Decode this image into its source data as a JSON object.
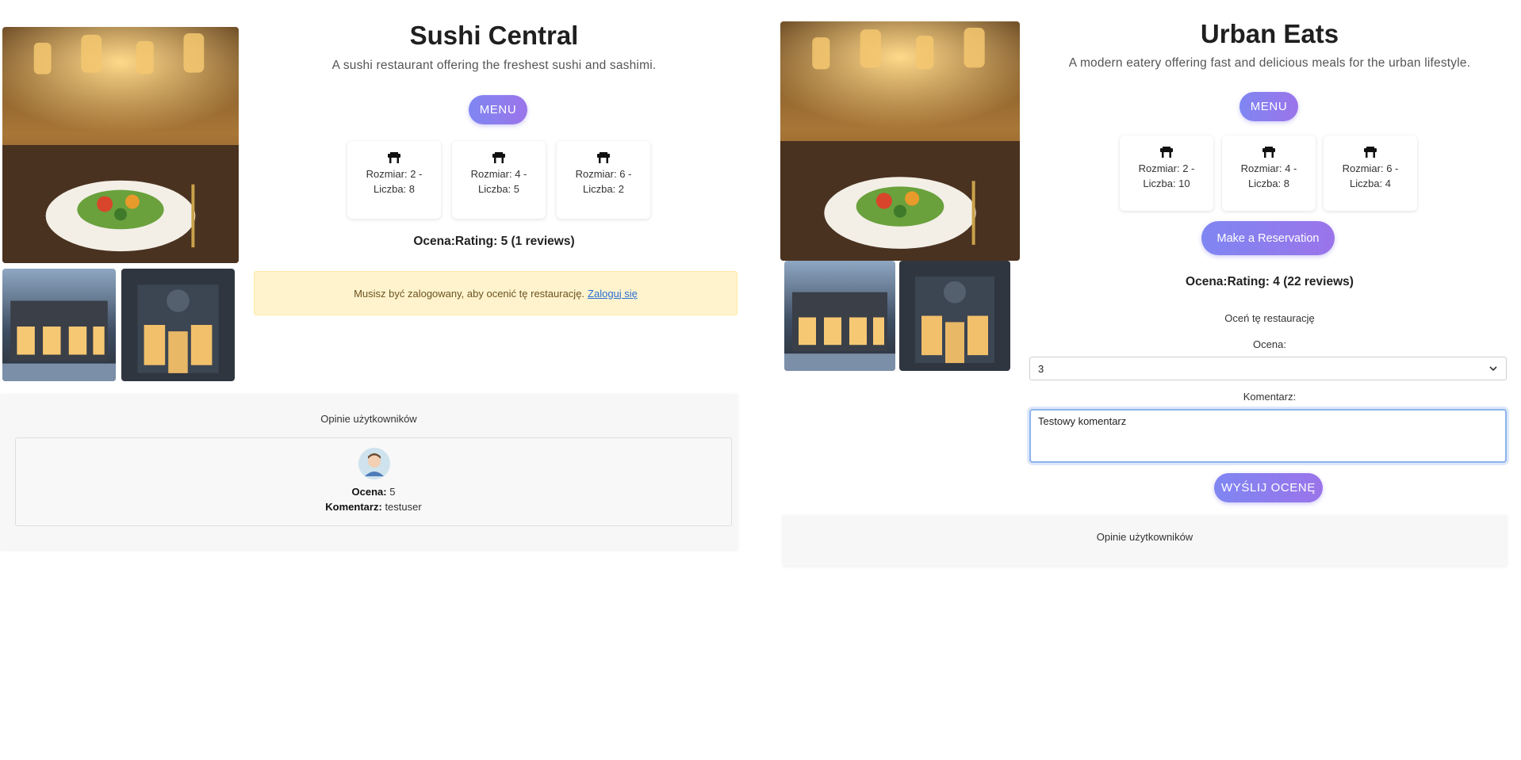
{
  "left": {
    "name": "Sushi Central",
    "description": "A sushi restaurant offering the freshest sushi and sashimi.",
    "menu_label": "MENU",
    "tables": [
      {
        "size": "Rozmiar: 2 -",
        "count": "Liczba: 8"
      },
      {
        "size": "Rozmiar: 4 -",
        "count": "Liczba: 5"
      },
      {
        "size": "Rozmiar: 6 -",
        "count": "Liczba: 2"
      }
    ],
    "rating": "Ocena:Rating: 5 (1 reviews)",
    "login_notice": "Musisz być zalogowany, aby ocenić tę restaurację.",
    "login_link": "Zaloguj się",
    "reviews_title": "Opinie użytkowników",
    "review": {
      "rating_label": "Ocena:",
      "rating_value": "5",
      "comment_label": "Komentarz:",
      "comment_value": "testuser"
    }
  },
  "right": {
    "name": "Urban Eats",
    "description": "A modern eatery offering fast and delicious meals for the urban lifestyle.",
    "menu_label": "MENU",
    "tables": [
      {
        "size": "Rozmiar: 2 -",
        "count": "Liczba: 10"
      },
      {
        "size": "Rozmiar: 4 -",
        "count": "Liczba: 8"
      },
      {
        "size": "Rozmiar: 6 -",
        "count": "Liczba: 4"
      }
    ],
    "reserve_label": "Make a Reservation",
    "rating": "Ocena:Rating: 4 (22 reviews)",
    "form_title": "Oceń tę restaurację",
    "rating_field_label": "Ocena:",
    "rating_selected": "3",
    "comment_field_label": "Komentarz:",
    "comment_value": "Testowy komentarz",
    "submit_label": "WYŚLIJ OCENĘ",
    "reviews_title": "Opinie użytkowników"
  },
  "icons": {
    "table": "table-icon",
    "avatar": "user-avatar-icon",
    "select": "chevron-down-icon"
  },
  "colors": {
    "accent_start": "#7f86f2",
    "accent_end": "#9b74ea",
    "alert_bg": "#fff3cd",
    "link": "#2a6fd6"
  }
}
